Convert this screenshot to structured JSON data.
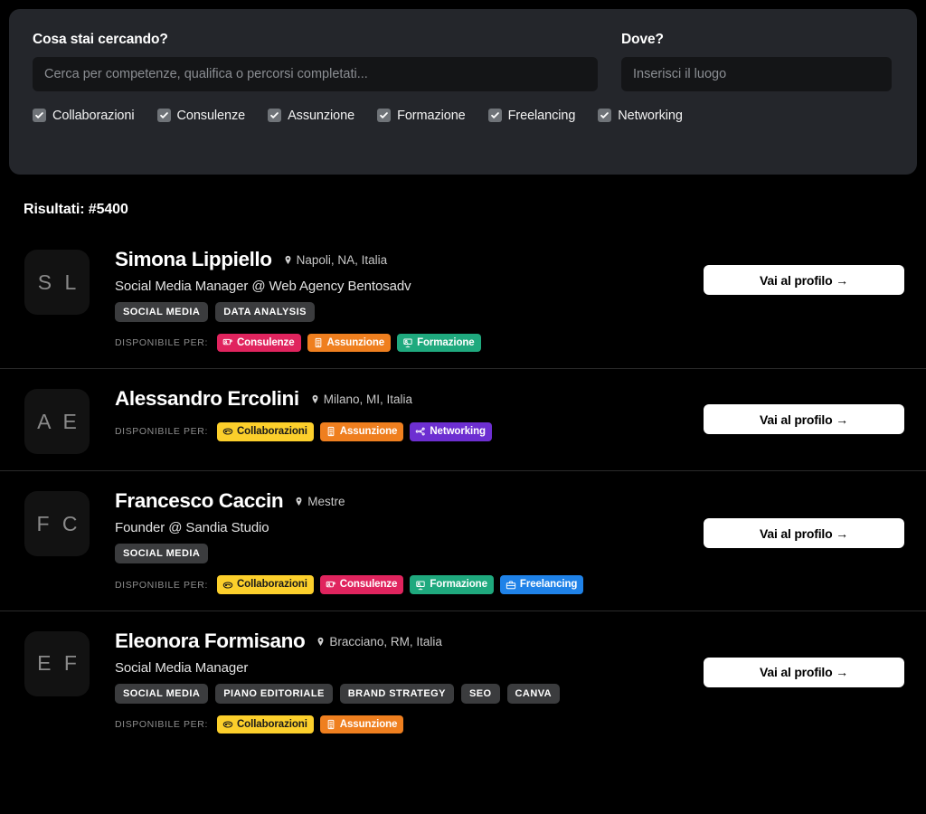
{
  "search": {
    "what_label": "Cosa stai cercando?",
    "what_placeholder": "Cerca per competenze, qualifica o percorsi completati...",
    "what_value": "",
    "where_label": "Dove?",
    "where_placeholder": "Inserisci il luogo",
    "where_value": "",
    "filters": [
      {
        "label": "Collaborazioni",
        "checked": true
      },
      {
        "label": "Consulenze",
        "checked": true
      },
      {
        "label": "Assunzione",
        "checked": true
      },
      {
        "label": "Formazione",
        "checked": true
      },
      {
        "label": "Freelancing",
        "checked": true
      },
      {
        "label": "Networking",
        "checked": true
      }
    ]
  },
  "results": {
    "title": "Risultati: #5400",
    "available_label": "DISPONIBILE PER:",
    "cta_label": "Vai al profilo →",
    "badge_colors": {
      "Collaborazioni": "#fccf2b",
      "Consulenze": "#e0245e",
      "Assunzione": "#ef7f1f",
      "Formazione": "#1fa97e",
      "Freelancing": "#1f82e8",
      "Networking": "#6d2fd1"
    },
    "cards": [
      {
        "initials": "S L",
        "name": "Simona Lippiello",
        "location": "Napoli, NA, Italia",
        "headline": "Social Media Manager @ Web Agency Bentosadv",
        "skills": [
          "SOCIAL MEDIA",
          "DATA ANALYSIS"
        ],
        "available": [
          "Consulenze",
          "Assunzione",
          "Formazione"
        ]
      },
      {
        "initials": "A E",
        "name": "Alessandro Ercolini",
        "location": "Milano, MI, Italia",
        "headline": "",
        "skills": [],
        "available": [
          "Collaborazioni",
          "Assunzione",
          "Networking"
        ]
      },
      {
        "initials": "F C",
        "name": "Francesco Caccin",
        "location": "Mestre",
        "headline": "Founder @ Sandia Studio",
        "skills": [
          "SOCIAL MEDIA"
        ],
        "available": [
          "Collaborazioni",
          "Consulenze",
          "Formazione",
          "Freelancing"
        ]
      },
      {
        "initials": "E F",
        "name": "Eleonora Formisano",
        "location": "Bracciano, RM, Italia",
        "headline": "Social Media Manager",
        "skills": [
          "SOCIAL MEDIA",
          "PIANO EDITORIALE",
          "BRAND STRATEGY",
          "SEO",
          "CANVA"
        ],
        "available": [
          "Collaborazioni",
          "Assunzione"
        ]
      }
    ]
  },
  "icons": {
    "checkbox": "check-icon",
    "location": "map-pin-icon",
    "Collaborazioni": "handshake-icon",
    "Consulenze": "presentation-person-icon",
    "Assunzione": "building-icon",
    "Formazione": "whiteboard-teacher-icon",
    "Freelancing": "briefcase-icon",
    "Networking": "network-nodes-icon"
  }
}
